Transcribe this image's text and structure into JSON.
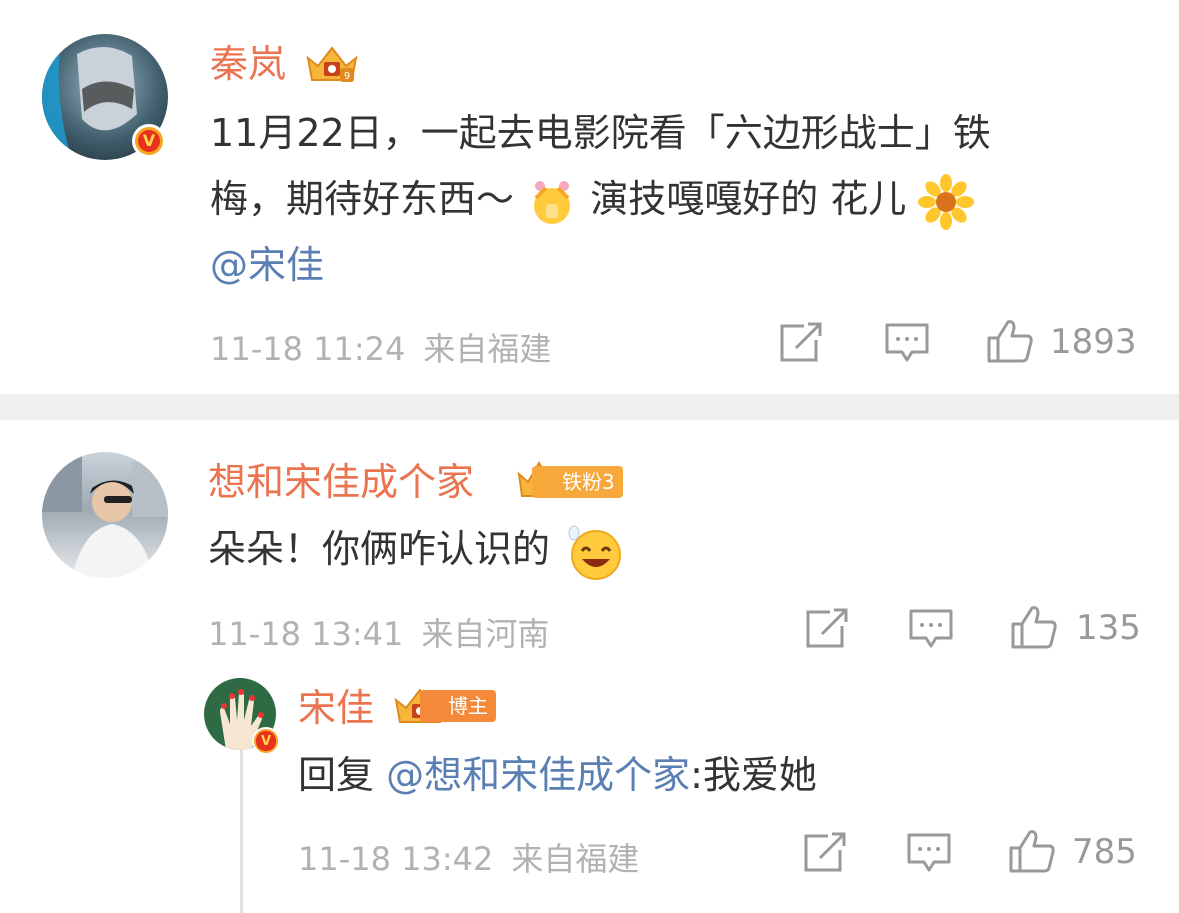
{
  "comments": [
    {
      "name": "秦岚",
      "text_part1": "11月22日，一起去电影院看「六边形战士」铁",
      "text_part2a": "梅，期待好东西～",
      "text_part2b": " 演技嘎嘎好的 花儿",
      "mention": "@宋佳",
      "time": "11-18 11:24",
      "location": "来自福建",
      "likes": "1893"
    },
    {
      "name": "想和宋佳成个家",
      "badge": "铁粉3",
      "text": "朵朵！你俩咋认识的",
      "time": "11-18 13:41",
      "location": "来自河南",
      "likes": "135"
    },
    {
      "name": "宋佳",
      "badge": "博主",
      "reply_prefix": "回复 ",
      "reply_mention": "@想和宋佳成个家",
      "reply_text": ":我爱她",
      "time": "11-18 13:42",
      "location": "来自福建",
      "likes": "785"
    }
  ],
  "colors": {
    "name": "#eb7350",
    "mention": "#5a80b3",
    "meta": "#b2b2b2",
    "divider": "#f0f0f0"
  },
  "icons": [
    "verified-v-icon",
    "crown-icon",
    "share-icon",
    "comment-icon",
    "like-icon",
    "sunflower-emoji",
    "praying-emoji",
    "grinning-emoji"
  ]
}
